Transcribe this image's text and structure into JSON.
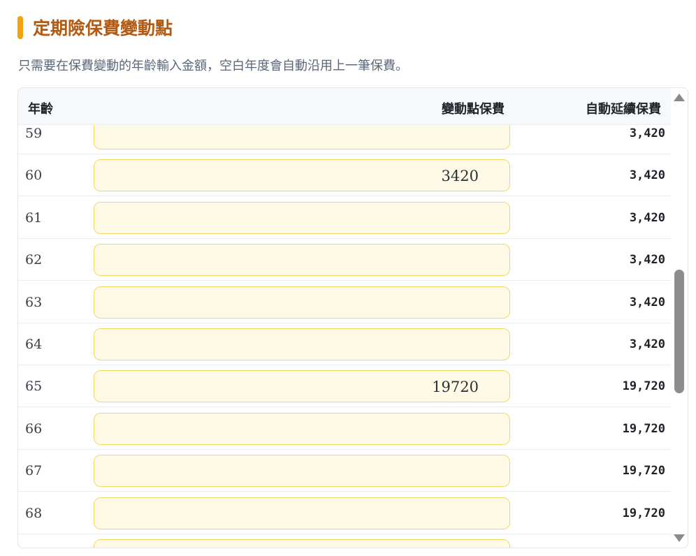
{
  "section": {
    "title": "定期險保費變動點",
    "hint": "只需要在保費變動的年齡輸入金額，空白年度會自動沿用上一筆保費。"
  },
  "table": {
    "headers": {
      "age": "年齡",
      "change": "變動點保費",
      "auto": "自動延續保費"
    },
    "rows": [
      {
        "age": "59",
        "input": "",
        "auto": "3,420"
      },
      {
        "age": "60",
        "input": "3420",
        "auto": "3,420"
      },
      {
        "age": "61",
        "input": "",
        "auto": "3,420"
      },
      {
        "age": "62",
        "input": "",
        "auto": "3,420"
      },
      {
        "age": "63",
        "input": "",
        "auto": "3,420"
      },
      {
        "age": "64",
        "input": "",
        "auto": "3,420"
      },
      {
        "age": "65",
        "input": "19720",
        "auto": "19,720"
      },
      {
        "age": "66",
        "input": "",
        "auto": "19,720"
      },
      {
        "age": "67",
        "input": "",
        "auto": "19,720"
      },
      {
        "age": "68",
        "input": "",
        "auto": "19,720"
      },
      {
        "age": "",
        "input": "",
        "auto": ""
      }
    ]
  },
  "colors": {
    "accent": "#f2a20c",
    "title": "#b35a12",
    "input_bg": "#fefae6",
    "input_border": "#f3d66b"
  }
}
